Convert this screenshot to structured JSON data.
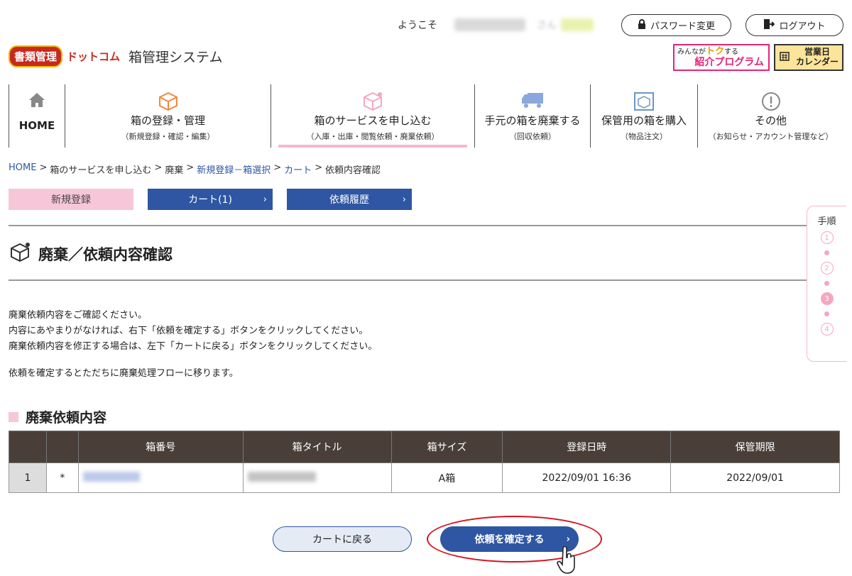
{
  "header": {
    "welcome": "ようこそ",
    "san": "さん",
    "password_button": "パスワード変更",
    "logout_button": "ログアウト",
    "logo_part1": "書類管理",
    "logo_part2": "ドットコム",
    "system_name": "箱管理システム",
    "referral_top": "みんなが",
    "referral_toku": "トク",
    "referral_suru": "する",
    "referral_main": "紹介プログラム",
    "calendar_line1": "営業日",
    "calendar_line2": "カレンダー"
  },
  "nav": {
    "home": "HOME",
    "items": [
      {
        "title": "箱の登録・管理",
        "sub": "（新規登録・確認・編集）"
      },
      {
        "title": "箱のサービスを申し込む",
        "sub": "（入庫・出庫・閲覧依頼・廃棄依頼）"
      },
      {
        "title": "手元の箱を廃棄する",
        "sub": "（回収依頼）"
      },
      {
        "title": "保管用の箱を購入",
        "sub": "（物品注文）"
      },
      {
        "title": "その他",
        "sub": "（お知らせ・アカウント管理など）"
      }
    ]
  },
  "breadcrumb": {
    "home": "HOME",
    "sep": ">",
    "c1": "箱のサービスを申し込む",
    "c2": "廃棄",
    "c3": "新規登録－箱選択",
    "c4": "カート",
    "c5": "依頼内容確認"
  },
  "tabs": {
    "new": "新規登録",
    "cart": "カート(1)",
    "history": "依頼履歴"
  },
  "page": {
    "title": "廃棄／依頼内容確認",
    "desc1": "廃棄依頼内容をご確認ください。",
    "desc2": "内容にあやまりがなければ、右下「依頼を確定する」ボタンをクリックしてください。",
    "desc3": "廃棄依頼内容を修正する場合は、左下「カートに戻る」ボタンをクリックしてください。",
    "desc4": "依頼を確定するとただちに廃棄処理フローに移ります。",
    "section_title": "廃棄依頼内容"
  },
  "table": {
    "headers": [
      "",
      "",
      "箱番号",
      "箱タイトル",
      "箱サイズ",
      "登録日時",
      "保管期限"
    ],
    "rows": [
      {
        "num": "1",
        "mark": "*",
        "box_size": "A箱",
        "registered": "2022/09/01 16:36",
        "limit": "2022/09/01"
      }
    ]
  },
  "buttons": {
    "back": "カートに戻る",
    "confirm": "依頼を確定する"
  },
  "steps": {
    "label": "手順",
    "items": [
      "1",
      "2",
      "3",
      "4"
    ],
    "current": 3
  },
  "colors": {
    "accent_blue": "#2f56a3",
    "pink": "#f7c6d8",
    "table_header": "#4a3f38",
    "highlight_red": "#d7141f"
  }
}
